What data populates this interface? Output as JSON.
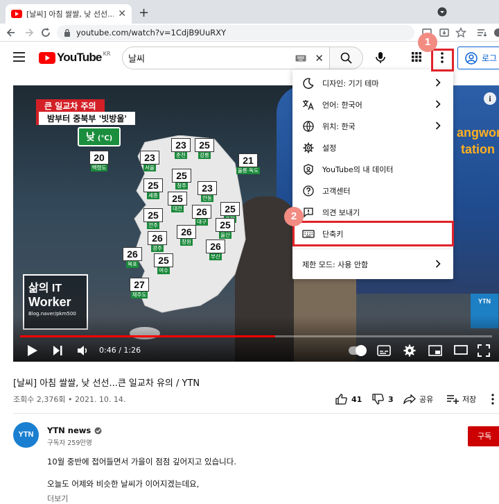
{
  "browser": {
    "tab_title": "[날씨] 아침 쌀쌀, 낮 선선...큰 일",
    "new_tab": "+",
    "url": "youtube.com/watch?v=1CdjB9UuRXY"
  },
  "youtube": {
    "logo_text": "YouTube",
    "logo_region": "KR",
    "search_value": "날씨",
    "login_label": "로그"
  },
  "video": {
    "banner_red": "큰 일교차 주의",
    "banner_white": "밤부터 중북부 '빗방울'",
    "day_label": "낮",
    "day_unit": "(℃)",
    "cities": [
      {
        "t": "20",
        "n": "백령도"
      },
      {
        "t": "23",
        "n": "서울"
      },
      {
        "t": "23",
        "n": "춘천"
      },
      {
        "t": "25",
        "n": "강릉"
      },
      {
        "t": "21",
        "n": "울릉·독도"
      },
      {
        "t": "25",
        "n": "세종"
      },
      {
        "t": "25",
        "n": "청주"
      },
      {
        "t": "23",
        "n": "안동"
      },
      {
        "t": "25",
        "n": "대전"
      },
      {
        "t": "25",
        "n": "전주"
      },
      {
        "t": "26",
        "n": "대구"
      },
      {
        "t": "25",
        "n": "포항"
      },
      {
        "t": "26",
        "n": "광주"
      },
      {
        "t": "26",
        "n": "창원"
      },
      {
        "t": "25",
        "n": "울산"
      },
      {
        "t": "26",
        "n": "목포"
      },
      {
        "t": "25",
        "n": "여수"
      },
      {
        "t": "26",
        "n": "부산"
      },
      {
        "t": "27",
        "n": "제주도"
      }
    ],
    "watermark_line1": "삶의 IT",
    "watermark_line2": "Worker",
    "watermark_url": "Blog.naver/pkm500",
    "bg_text_ytn": "YTN",
    "bg_text_gangwon": "angwon",
    "bg_text_station": "tation",
    "time": "0:46 / 1:26",
    "progress": 0.54
  },
  "menu": {
    "items": [
      {
        "label": "디자인: 기기 테마",
        "icon": "moon-icon",
        "chevron": true
      },
      {
        "label": "언어: 한국어",
        "icon": "translate-icon",
        "chevron": true
      },
      {
        "label": "위치: 한국",
        "icon": "globe-icon",
        "chevron": true
      },
      {
        "label": "설정",
        "icon": "gear-icon",
        "chevron": false
      },
      {
        "label": "YouTube의 내 데이터",
        "icon": "shield-user-icon",
        "chevron": false
      },
      {
        "label": "고객센터",
        "icon": "help-icon",
        "chevron": false
      },
      {
        "label": "의견 보내기",
        "icon": "feedback-icon",
        "chevron": false
      },
      {
        "label": "단축키",
        "icon": "keyboard-icon",
        "chevron": false
      }
    ],
    "restricted": "제한 모드: 사용 안함"
  },
  "annotations": {
    "step1": "1",
    "step2": "2",
    "highlight_color": "#e0222a"
  },
  "info": {
    "title": "[날씨] 아침 쌀쌀, 낮 선선...큰 일교차 유의 / YTN",
    "views": "조회수 2,376회 • 2021. 10. 14.",
    "likes": "41",
    "dislikes": "3",
    "share": "공유",
    "save": "저장",
    "channel_name": "YTN news",
    "channel_avatar": "YTN",
    "subscribers": "구독자 259만명",
    "subscribe": "구독",
    "desc1": "10월 중반에 접어들면서 가을이 점점 깊어지고 있습니다.",
    "desc2": "오늘도 어제와 비슷한 날씨가 이어지겠는데요,",
    "more": "더보기"
  }
}
